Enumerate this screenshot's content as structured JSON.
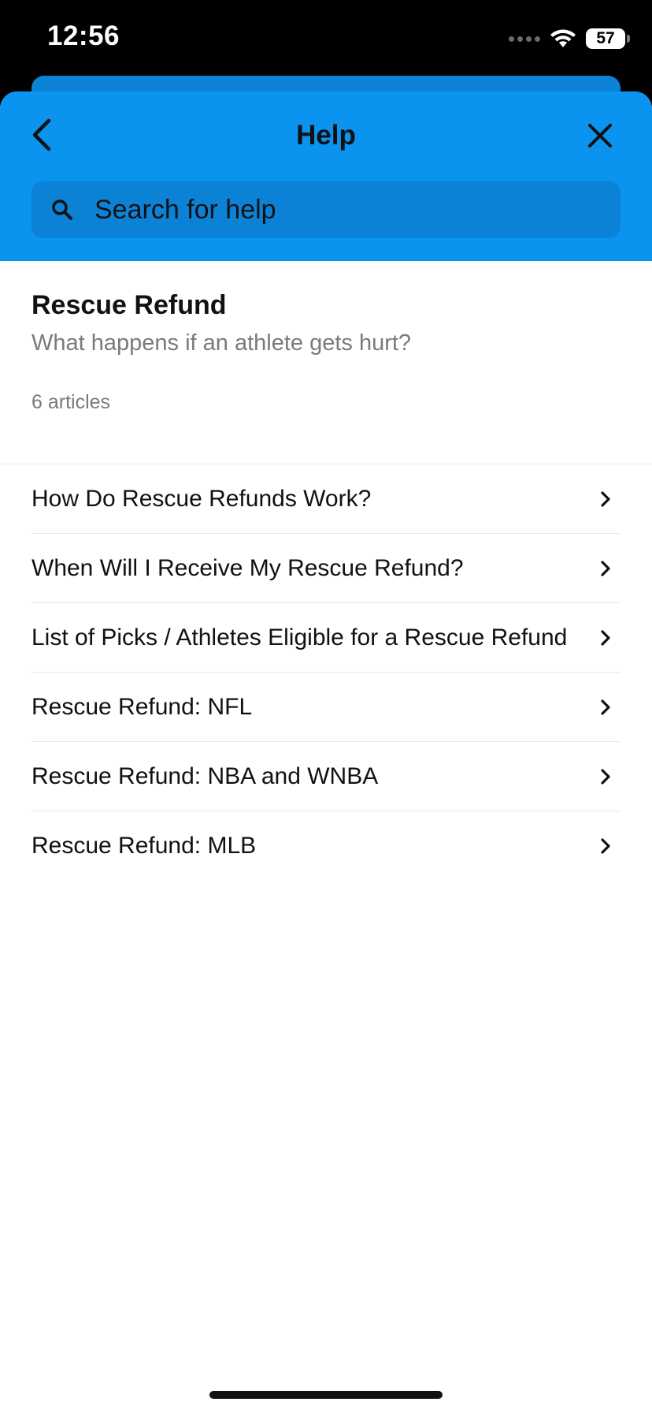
{
  "status_bar": {
    "time": "12:56",
    "battery": "57",
    "icons": [
      "cellular-signal-icon",
      "wifi-icon",
      "battery-icon"
    ]
  },
  "header": {
    "title": "Help",
    "back_icon": "chevron-left-icon",
    "close_icon": "close-icon",
    "background_color": "#0a93ef"
  },
  "search": {
    "placeholder": "Search for help",
    "value": "",
    "icon": "search-icon"
  },
  "section": {
    "title": "Rescue Refund",
    "subtitle": "What happens if an athlete gets hurt?",
    "count": "6 articles"
  },
  "articles": [
    {
      "label": "How Do Rescue Refunds Work?"
    },
    {
      "label": "When Will I Receive My Rescue Refund?"
    },
    {
      "label": "List of Picks / Athletes Eligible for a Rescue Refund"
    },
    {
      "label": "Rescue Refund: NFL"
    },
    {
      "label": "Rescue Refund: NBA and WNBA"
    },
    {
      "label": "Rescue Refund: MLB"
    }
  ]
}
